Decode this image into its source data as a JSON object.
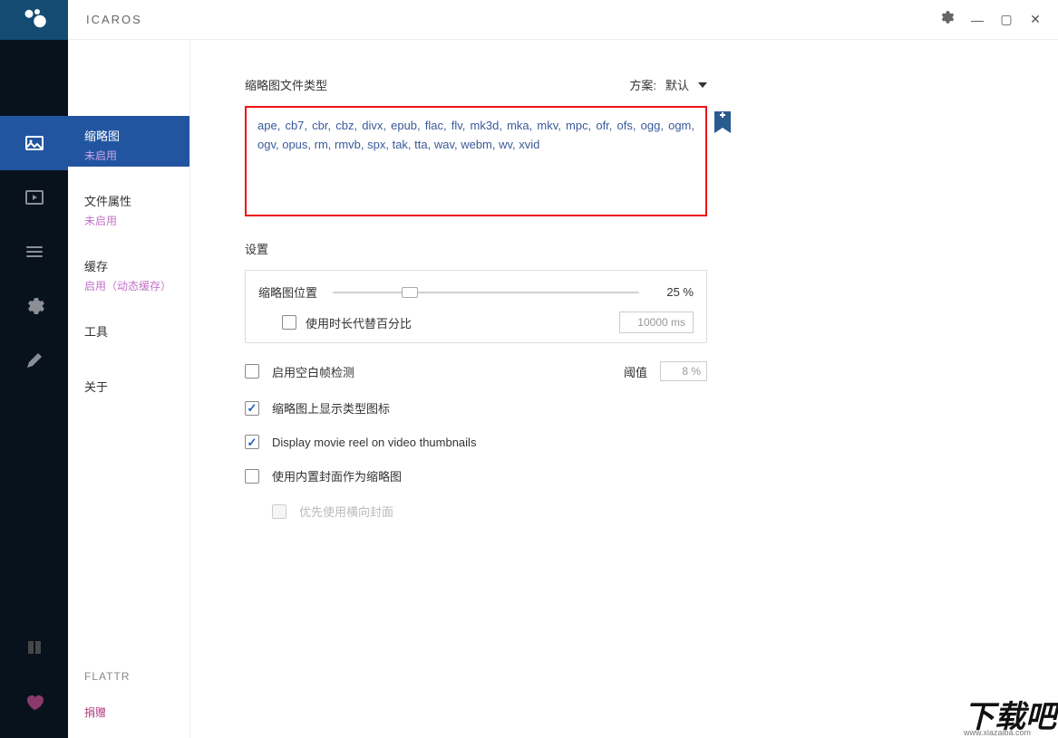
{
  "app": {
    "title": "ICAROS"
  },
  "sidebar": {
    "items": [
      {
        "label": "缩略图",
        "status": "未启用",
        "icon": "image-icon"
      },
      {
        "label": "文件属性",
        "status": "未启用",
        "icon": "play-icon"
      },
      {
        "label": "缓存",
        "status": "启用（动态缓存）",
        "icon": "stack-icon"
      },
      {
        "label": "工具",
        "status": "",
        "icon": "gear-icon"
      },
      {
        "label": "关于",
        "status": "",
        "icon": "pen-icon"
      }
    ],
    "flattr": "FLATTR",
    "donate": "捐赠"
  },
  "header": {
    "filetypes_label": "缩略图文件类型",
    "scheme_label": "方案:",
    "scheme_value": "默认"
  },
  "filetypes": "ape, cb7, cbr, cbz, divx, epub, flac, flv, mk3d, mka, mkv, mpc, ofr, ofs, ogg, ogm, ogv, opus, rm, rmvb, spx, tak, tta, wav, webm, wv, xvid",
  "settings": {
    "title": "设置",
    "thumb_pos_label": "缩略图位置",
    "thumb_pos_value": "25 %",
    "use_duration_label": "使用时长代替百分比",
    "duration_value": "10000 ms",
    "blank_frame_label": "启用空白帧检测",
    "threshold_label": "阈值",
    "threshold_value": "8 %",
    "show_type_icon_label": "缩略图上显示类型图标",
    "movie_reel_label": "Display movie reel on video thumbnails",
    "use_cover_label": "使用内置封面作为缩略图",
    "prefer_landscape_label": "优先使用横向封面"
  },
  "watermark": {
    "big": "下载吧",
    "sub": "www.xiazaiba.com"
  }
}
